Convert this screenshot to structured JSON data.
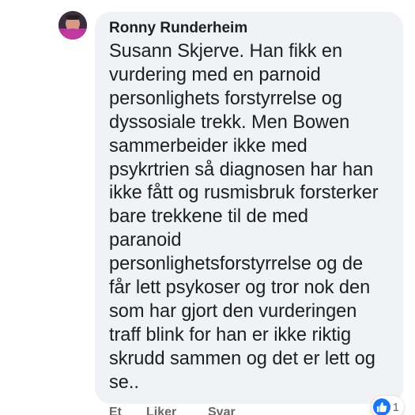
{
  "comment": {
    "author": "Ronny Runderheim",
    "text": "Susann Skjerve. Han fikk en\nvurdering med en parnoid\npersonlighets forstyrrelse og\ndyssosiale trekk. Men Bowen\nsammerbeider ikke med\npsykrtrien så diagnosen har han\nikke fått og rusmisbruk forsterker\nbare trekkene til de med\nparanoid\npersonlighetsforstyrrelse og de\nfår lett psykoser og tror nok den\nsom har gjort den vurderingen\ntraff blink for han er ikke riktig\nskrudd sammen og det er lett og\nse.."
  },
  "reactions": {
    "icon": "like-icon",
    "count": "1",
    "color": "#1877f2"
  },
  "actions": {
    "time": "Et",
    "like": "Liker",
    "reply": "Svar"
  },
  "colors": {
    "bubble": "#f0f2f5",
    "text": "#1c1e21",
    "meta": "#65676b"
  }
}
